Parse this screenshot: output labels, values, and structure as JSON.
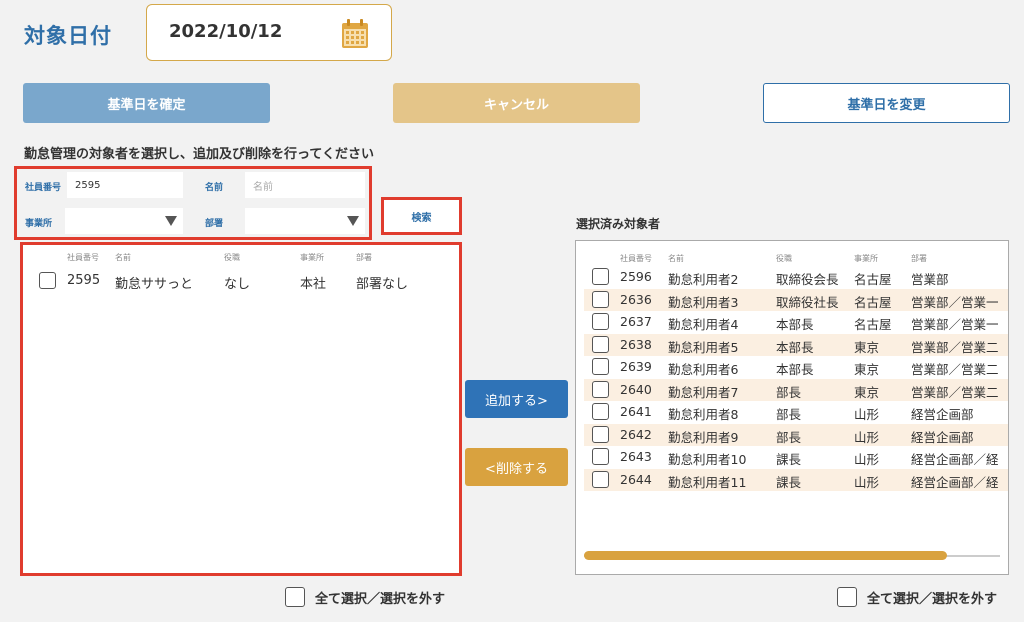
{
  "header": {
    "title": "対象日付",
    "date_value": "2022/10/12",
    "calendar_icon": "calendar-icon",
    "accent_color": "#2f6fa8"
  },
  "actions": {
    "confirm_label": "基準日を確定",
    "cancel_label": "キャンセル",
    "change_label": "基準日を変更"
  },
  "instruction": "勤怠管理の対象者を選択し、追加及び削除を行ってください",
  "search": {
    "employee_no_label": "社員番号",
    "employee_no_value": "2595",
    "name_label": "名前",
    "name_placeholder": "名前",
    "office_label": "事業所",
    "office_value": "",
    "dept_label": "部署",
    "dept_value": "",
    "search_button": "検索"
  },
  "left_list": {
    "headers": [
      "社員番号",
      "名前",
      "役職",
      "事業所",
      "部署"
    ],
    "rows": [
      {
        "no": "2595",
        "name": "勤怠ササっと",
        "title": "なし",
        "office": "本社",
        "dept": "部署なし"
      }
    ]
  },
  "middle": {
    "add_label": "追加する>",
    "remove_label": "<削除する"
  },
  "right_list": {
    "title": "選択済み対象者",
    "headers": [
      "社員番号",
      "名前",
      "役職",
      "事業所",
      "部署"
    ],
    "rows": [
      {
        "no": "2596",
        "name": "勤怠利用者2",
        "title": "取締役会長",
        "office": "名古屋",
        "dept": "営業部"
      },
      {
        "no": "2636",
        "name": "勤怠利用者3",
        "title": "取締役社長",
        "office": "名古屋",
        "dept": "営業部／営業一"
      },
      {
        "no": "2637",
        "name": "勤怠利用者4",
        "title": "本部長",
        "office": "名古屋",
        "dept": "営業部／営業一"
      },
      {
        "no": "2638",
        "name": "勤怠利用者5",
        "title": "本部長",
        "office": "東京",
        "dept": "営業部／営業二"
      },
      {
        "no": "2639",
        "name": "勤怠利用者6",
        "title": "本部長",
        "office": "東京",
        "dept": "営業部／営業二"
      },
      {
        "no": "2640",
        "name": "勤怠利用者7",
        "title": "部長",
        "office": "東京",
        "dept": "営業部／営業二"
      },
      {
        "no": "2641",
        "name": "勤怠利用者8",
        "title": "部長",
        "office": "山形",
        "dept": "経営企画部"
      },
      {
        "no": "2642",
        "name": "勤怠利用者9",
        "title": "部長",
        "office": "山形",
        "dept": "経営企画部"
      },
      {
        "no": "2643",
        "name": "勤怠利用者10",
        "title": "課長",
        "office": "山形",
        "dept": "経営企画部／経"
      },
      {
        "no": "2644",
        "name": "勤怠利用者11",
        "title": "課長",
        "office": "山形",
        "dept": "経営企画部／経"
      }
    ]
  },
  "footer": {
    "select_all_left": "全て選択／選択を外す",
    "select_all_right": "全て選択／選択を外す"
  }
}
